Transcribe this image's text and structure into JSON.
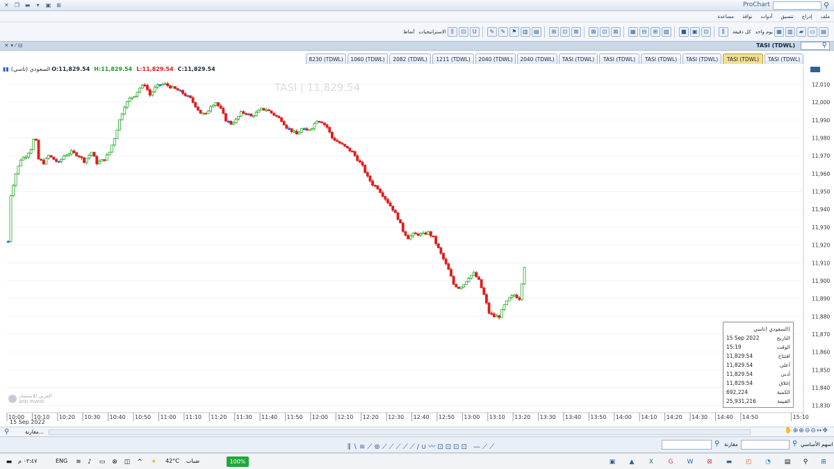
{
  "window": {
    "title": "ProChart"
  },
  "menu": [
    "ملف",
    "إدراج",
    "تنسيق",
    "أدوات",
    "نوافذ",
    "مساعدة"
  ],
  "toolbar": {
    "period_label": "يوم واحد",
    "interval_label": "كل دقيقة",
    "strategies_label": "الاستراتيجيات",
    "templates_label": "أنماط"
  },
  "chart_window": {
    "title": "TASI (TDWL)"
  },
  "tabs": [
    {
      "label": "8230 (TDWL)"
    },
    {
      "label": "1060 (TDWL)"
    },
    {
      "label": "2082 (TDWL)"
    },
    {
      "label": "1211 (TDWL)"
    },
    {
      "label": "2040 (TDWL)"
    },
    {
      "label": "2040 (TDWL)"
    },
    {
      "label": "TASI (TDWL)"
    },
    {
      "label": "TASI (TDWL)"
    },
    {
      "label": "TASI (TDWL)"
    },
    {
      "label": "TASI (TDWL)"
    },
    {
      "label": "TASI (TDWL)",
      "active": true
    },
    {
      "label": "TASI (TDWL)"
    }
  ],
  "ohlc": {
    "name": "(السعودي (تاسي",
    "open": "O:11,829.54",
    "high": "H:11,829.54",
    "low": "L:11,829.54",
    "close": "C:11,829.54"
  },
  "watermark": "TASI | 11,829.54",
  "logo_text": "العربي للاستثمار",
  "logo_sub": "anb invest",
  "date_label": "15 Sep 2022",
  "tooltip": {
    "title": "(السعودي (تاسي",
    "rows": [
      {
        "label": "التاريخ",
        "value": "15 Sep 2022"
      },
      {
        "label": "الوقت",
        "value": "15:19"
      },
      {
        "label": "افتتاح",
        "value": "11,829.54"
      },
      {
        "label": "أعلى",
        "value": "11,829.54"
      },
      {
        "label": "أدنى",
        "value": "11,829.54"
      },
      {
        "label": "إغلاق",
        "value": "11,829.54"
      },
      {
        "label": "الكمية",
        "value": "692,224"
      },
      {
        "label": "القيمة",
        "value": "25,931,216"
      }
    ]
  },
  "scroll": {
    "compare_label": "مقارنة..."
  },
  "drawbar": {
    "compare_label": "مقارنة",
    "search_label": "اسهم الأساسي"
  },
  "taskbar": {
    "time": "٠٣:٤٧ م",
    "lang": "ENG",
    "temp": "42°C",
    "weather": "ضباب",
    "battery": "100%"
  },
  "colors": {
    "up": "#22a722",
    "down": "#e31b1b",
    "flat": "#2563d8",
    "accent": "#2f5f96"
  },
  "chart_data": {
    "type": "candlestick",
    "title": "TASI | 11,829.54",
    "x_ticks": [
      "10:00",
      "10:10",
      "10:20",
      "10:30",
      "10:40",
      "10:50",
      "11:00",
      "11:10",
      "11:20",
      "11:30",
      "11:40",
      "11:50",
      "12:00",
      "12:10",
      "12:20",
      "12:30",
      "12:40",
      "12:50",
      "13:00",
      "13:10",
      "13:20",
      "13:30",
      "13:40",
      "13:50",
      "14:00",
      "14:10",
      "14:20",
      "14:30",
      "14:40",
      "14:50",
      "15:10"
    ],
    "y_ticks": [
      12010,
      12000,
      11990,
      11980,
      11970,
      11960,
      11950,
      11940,
      11930,
      11920,
      11910,
      11900,
      11890,
      11880,
      11870,
      11860,
      11850,
      11840,
      11830
    ],
    "ylim": [
      11826,
      12016
    ],
    "x_range": [
      "10:00",
      "15:12"
    ],
    "close_path": [
      [
        0,
        11922
      ],
      [
        1,
        11948
      ],
      [
        3,
        11960
      ],
      [
        5,
        11968
      ],
      [
        7,
        11970
      ],
      [
        9,
        11974
      ],
      [
        10,
        11979
      ],
      [
        11,
        11978
      ],
      [
        12,
        11968
      ],
      [
        14,
        11966
      ],
      [
        16,
        11970
      ],
      [
        18,
        11968
      ],
      [
        20,
        11966
      ],
      [
        22,
        11970
      ],
      [
        25,
        11972
      ],
      [
        28,
        11970
      ],
      [
        30,
        11967
      ],
      [
        33,
        11972
      ],
      [
        35,
        11966
      ],
      [
        38,
        11968
      ],
      [
        40,
        11972
      ],
      [
        42,
        11980
      ],
      [
        44,
        11990
      ],
      [
        46,
        11998
      ],
      [
        48,
        12002
      ],
      [
        50,
        12004
      ],
      [
        52,
        12008
      ],
      [
        54,
        12010
      ],
      [
        56,
        12004
      ],
      [
        58,
        12008
      ],
      [
        60,
        12010
      ],
      [
        62,
        12010
      ],
      [
        65,
        12008
      ],
      [
        68,
        12006
      ],
      [
        70,
        12004
      ],
      [
        72,
        12002
      ],
      [
        74,
        11998
      ],
      [
        76,
        11994
      ],
      [
        78,
        11993
      ],
      [
        80,
        11998
      ],
      [
        82,
        12000
      ],
      [
        84,
        11996
      ],
      [
        86,
        11990
      ],
      [
        88,
        11988
      ],
      [
        90,
        11990
      ],
      [
        92,
        11994
      ],
      [
        94,
        11994
      ],
      [
        96,
        11992
      ],
      [
        98,
        11994
      ],
      [
        100,
        11996
      ],
      [
        102,
        11996
      ],
      [
        104,
        11994
      ],
      [
        106,
        11992
      ],
      [
        108,
        11990
      ],
      [
        110,
        11986
      ],
      [
        112,
        11984
      ],
      [
        114,
        11982
      ],
      [
        116,
        11985
      ],
      [
        118,
        11984
      ],
      [
        120,
        11986
      ],
      [
        122,
        11990
      ],
      [
        124,
        11989
      ],
      [
        126,
        11986
      ],
      [
        128,
        11980
      ],
      [
        130,
        11978
      ],
      [
        132,
        11976
      ],
      [
        134,
        11974
      ],
      [
        136,
        11972
      ],
      [
        138,
        11968
      ],
      [
        140,
        11964
      ],
      [
        142,
        11958
      ],
      [
        144,
        11954
      ],
      [
        146,
        11952
      ],
      [
        148,
        11948
      ],
      [
        150,
        11944
      ],
      [
        152,
        11940
      ],
      [
        154,
        11935
      ],
      [
        156,
        11928
      ],
      [
        158,
        11924
      ],
      [
        160,
        11926
      ],
      [
        162,
        11926
      ],
      [
        164,
        11926
      ],
      [
        166,
        11927
      ],
      [
        168,
        11924
      ],
      [
        170,
        11918
      ],
      [
        172,
        11912
      ],
      [
        174,
        11906
      ],
      [
        176,
        11898
      ],
      [
        178,
        11896
      ],
      [
        180,
        11898
      ],
      [
        182,
        11902
      ],
      [
        184,
        11904
      ],
      [
        186,
        11900
      ],
      [
        188,
        11892
      ],
      [
        190,
        11882
      ],
      [
        192,
        11880
      ],
      [
        194,
        11880
      ],
      [
        196,
        11886
      ],
      [
        198,
        11890
      ],
      [
        200,
        11892
      ],
      [
        202,
        11890
      ],
      [
        204,
        11908
      ]
    ],
    "minutes_span": [
      0,
      312
    ]
  }
}
